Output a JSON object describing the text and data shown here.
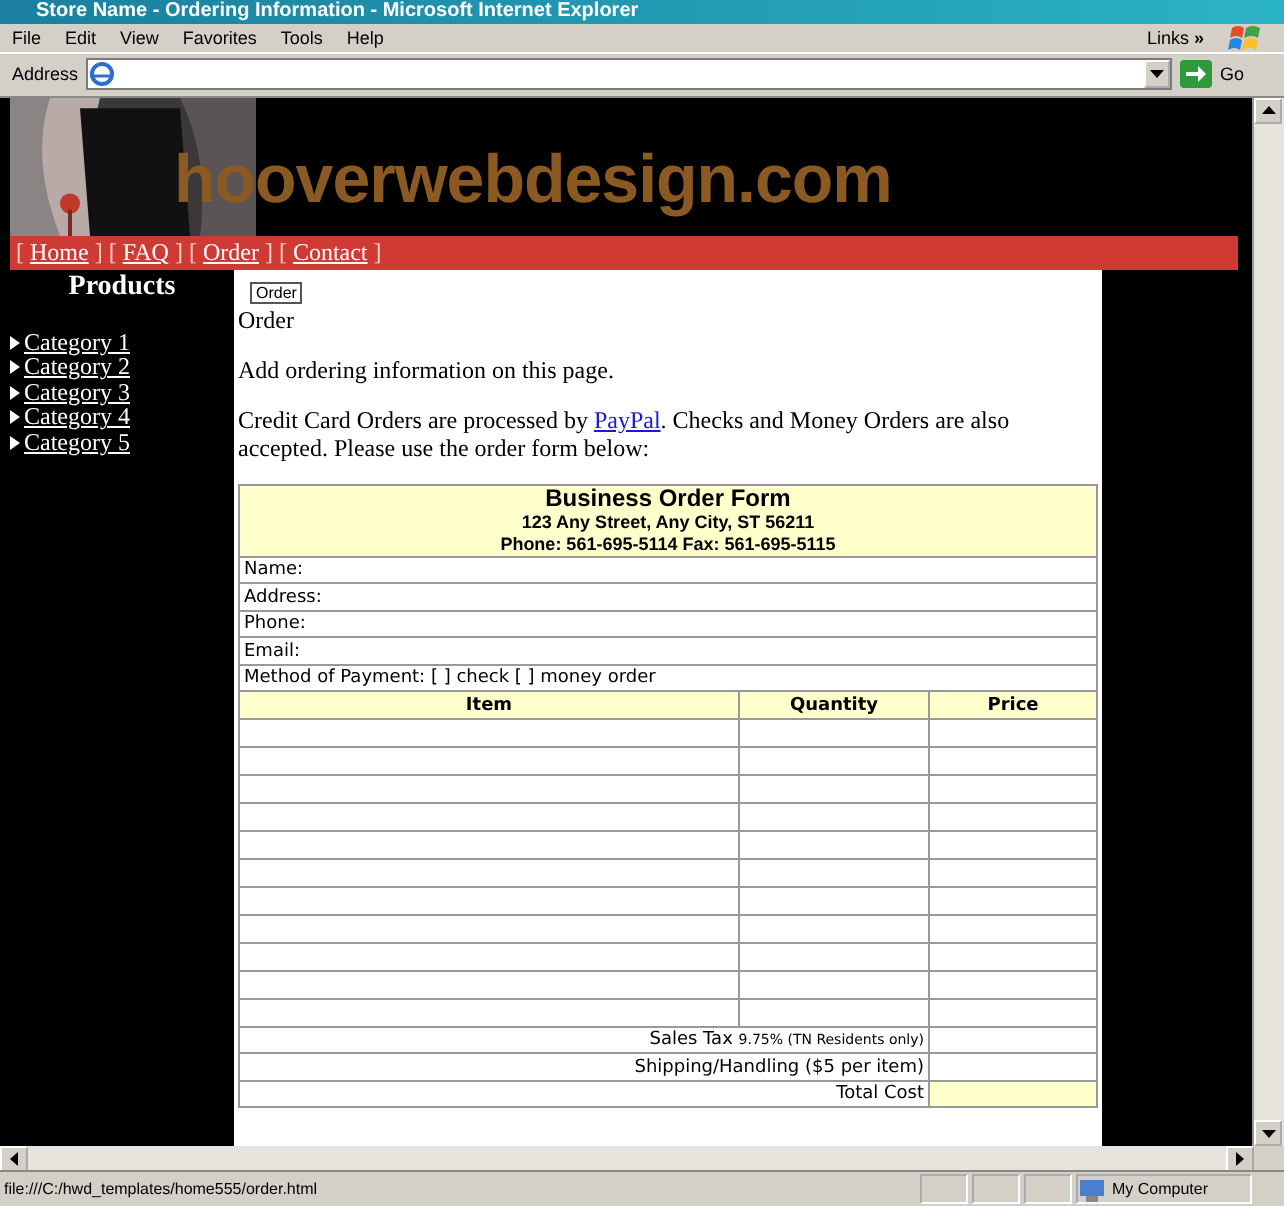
{
  "window": {
    "title": "Store Name - Ordering Information - Microsoft Internet Explorer"
  },
  "menu": [
    "File",
    "Edit",
    "View",
    "Favorites",
    "Tools",
    "Help"
  ],
  "links_label": "Links",
  "links_more": "»",
  "address": {
    "label": "Address",
    "go": "Go"
  },
  "site": {
    "logo": "hooverwebdesign.com",
    "nav": [
      {
        "label": "Home"
      },
      {
        "label": "FAQ"
      },
      {
        "label": "Order"
      },
      {
        "label": "Contact"
      }
    ],
    "bracket_open": "[",
    "bracket_close": "]"
  },
  "sidebar": {
    "title": "Products",
    "items": [
      "Category 1",
      "Category 2",
      "Category 3",
      "Category 4",
      "Category 5"
    ]
  },
  "content": {
    "image_alt": "Order",
    "heading": "Order",
    "intro": "Add ordering information on this page.",
    "pay_before": "Credit Card Orders are processed by ",
    "pay_link": "PayPal",
    "pay_after": ". Checks and Money Orders are also accepted. Please use the order form below:"
  },
  "form": {
    "title": "Business Order Form",
    "address": "123 Any Street, Any City, ST 56211",
    "phone": "Phone: 561-695-5114 Fax: 561-695-5115",
    "fields": [
      "Name:",
      "Address:",
      "Phone:",
      "Email:",
      "Method of Payment: [ ] check [ ] money order"
    ],
    "columns": [
      "Item",
      "Quantity",
      "Price"
    ],
    "sales_tax": {
      "label": "Sales Tax",
      "note": "9.75% (TN Residents only)"
    },
    "shipping": "Shipping/Handling ($5 per item)",
    "total": "Total Cost"
  },
  "status_bar": {
    "url": "file:///C:/hwd_templates/home555/order.html",
    "zone": "My Computer"
  }
}
